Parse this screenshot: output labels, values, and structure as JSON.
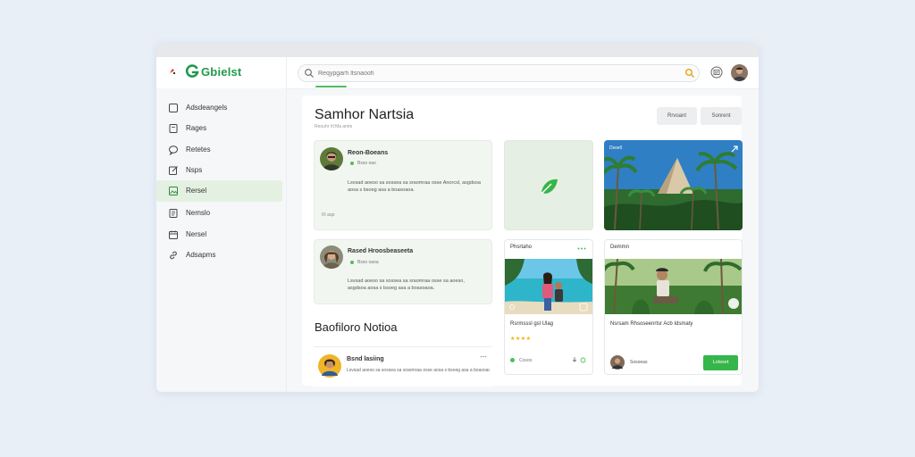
{
  "app": {
    "brand": "Gbielst"
  },
  "search": {
    "placeholder": "Reqypgarh ltsnaooh"
  },
  "sidebar": {
    "items": [
      {
        "label": "Adsdeangels",
        "icon": "square-icon"
      },
      {
        "label": "Rages",
        "icon": "page-icon"
      },
      {
        "label": "Retetes",
        "icon": "chat-bubble-icon"
      },
      {
        "label": "Nsps",
        "icon": "edit-icon"
      },
      {
        "label": "Rersel",
        "icon": "image-icon"
      },
      {
        "label": "Nemslo",
        "icon": "document-icon"
      },
      {
        "label": "Nersel",
        "icon": "calendar-icon"
      },
      {
        "label": "Adsapms",
        "icon": "link-icon"
      }
    ]
  },
  "main": {
    "title": "Samhor Nartsia",
    "subtitle": "Reouhr hl:Ma amle",
    "header_buttons": [
      "Rrvoant",
      "Sonrent"
    ]
  },
  "posts": [
    {
      "name": "Reon-Boeans",
      "meta": "Bsso oao",
      "text": "Lsvsad aoeso sa sossea sa sraomraa osse Anorcsl, asgdsoa aosa s bsoeg asa a boasoaoa.",
      "footer": "l© aqo"
    },
    {
      "name": "Rased Hroosbeaseeta",
      "meta": "Bsso oaoa",
      "text": "Lsvsad aoeso sa sossea sa sraomraa osse sa aoeso, asgdsoa aosa s bsoeg asa a boasoaoa."
    }
  ],
  "hero": {
    "label": "Dsoell"
  },
  "cards": [
    {
      "title": "Phsrtaho",
      "body": "Rsrmsssl gsl Ulag",
      "rating": 4,
      "footer": "Cosoo"
    },
    {
      "title": "Demmn",
      "body": "Nsrsam Rhsoseenrtsr Acb Idsmaty",
      "footer": "Sosoeas",
      "action": "Lotsset"
    }
  ],
  "section": {
    "title": "Baofiloro Notioa"
  },
  "notification": {
    "name": "Bsnd lasiing",
    "text": "Lsvsad aoeso sa sossea sa sraomraa osse aosa s bsoeg asa a boasoaoa."
  },
  "colors": {
    "accent": "#36b54a",
    "active_bg": "#e4f1e2",
    "brand": "#1f9a4a"
  }
}
